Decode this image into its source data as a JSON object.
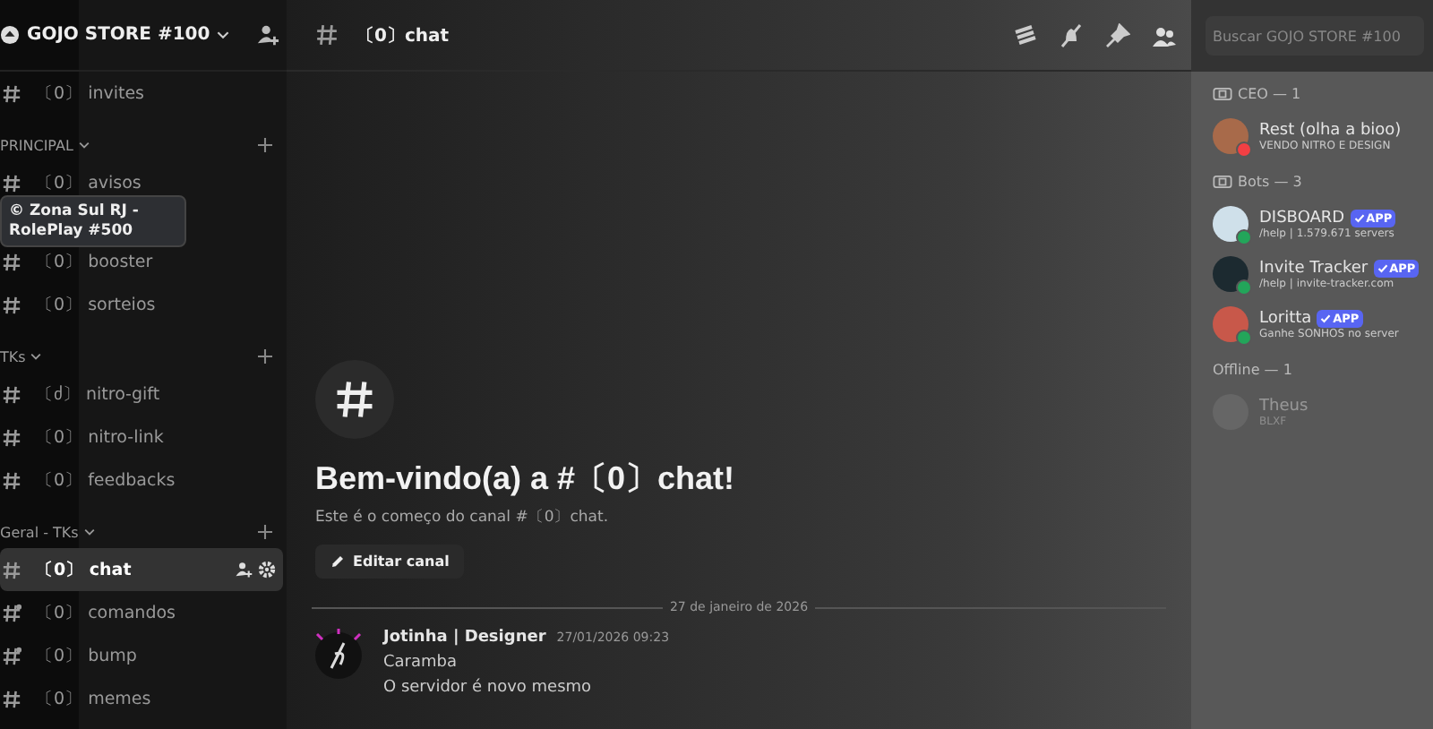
{
  "server": {
    "name": "GOJO STORE #100"
  },
  "categories": [
    {
      "channels": [
        {
          "kind": "hash",
          "prefix": "〔0〕",
          "name": "invites",
          "selected": false
        }
      ]
    },
    {
      "name": "PRINCIPAL",
      "channels": [
        {
          "kind": "hash",
          "prefix": "〔0〕",
          "name": "avisos",
          "selected": false
        },
        {
          "kind": "hash",
          "prefix": "〔0〕",
          "name": "booster",
          "selected": false
        },
        {
          "kind": "hash",
          "prefix": "〔0〕",
          "name": "sorteios",
          "selected": false
        }
      ]
    },
    {
      "name": "TKs",
      "channels": [
        {
          "kind": "hash",
          "prefix": "〔ძ〕",
          "name": "nitro-gift",
          "selected": false
        },
        {
          "kind": "hash",
          "prefix": "〔0〕",
          "name": "nitro-link",
          "selected": false
        },
        {
          "kind": "hash",
          "prefix": "〔0〕",
          "name": "feedbacks",
          "selected": false
        }
      ]
    },
    {
      "name": "Geral - TKs",
      "channels": [
        {
          "kind": "hash",
          "prefix": "〔0〕",
          "name": "chat",
          "selected": true
        },
        {
          "kind": "hash-dot",
          "prefix": "〔0〕",
          "name": "comandos",
          "selected": false
        },
        {
          "kind": "hash-dot",
          "prefix": "〔0〕",
          "name": "bump",
          "selected": false
        },
        {
          "kind": "hash",
          "prefix": "〔0〕",
          "name": "memes",
          "selected": false
        }
      ]
    }
  ],
  "tooltip": "© Zona Sul RJ - RolePlay #500",
  "topbar": {
    "channel": "〔0〕chat",
    "search": {
      "placeholder": "Buscar GOJO STORE #100"
    }
  },
  "welcome": {
    "title": "Bem-vindo(a) a #〔0〕chat!",
    "subtitle": "Este é o começo do canal #〔0〕chat.",
    "button": "Editar canal"
  },
  "divider_date": "27 de janeiro de 2026",
  "messages": [
    {
      "author": "Jotinha | Designer",
      "time": "27/01/2026 09:23",
      "lines": [
        "Caramba",
        "O servidor é novo mesmo"
      ]
    }
  ],
  "member_groups": [
    {
      "title": "CEO — 1",
      "members": [
        {
          "name": "Rest (olha a bioo)",
          "activity": "VENDO NITRO E DESIGN",
          "color": "#f23f43"
        }
      ]
    },
    {
      "title": "Bots — 3",
      "members": [
        {
          "name": "DISBOARD",
          "badge": "APP",
          "activity": "/help | 1.579.671 servers",
          "color": "#23a55a"
        },
        {
          "name": "Invite Tracker",
          "badge": "APP",
          "activity": "/help | invite-tracker.com",
          "color": "#23a55a"
        },
        {
          "name": "Loritta",
          "badge": "APP",
          "activity": "Ganhe SONHOS no server",
          "color": "#23a55a"
        }
      ]
    },
    {
      "title": "Offline — 1",
      "members": [
        {
          "name": "Theus",
          "activity": "BLXF",
          "offline": true
        }
      ]
    }
  ]
}
